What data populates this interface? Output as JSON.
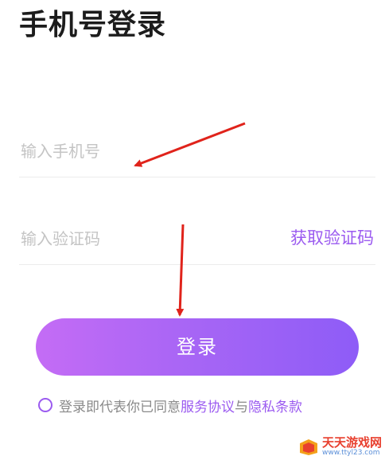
{
  "header": {
    "title": "手机号登录"
  },
  "phone": {
    "placeholder": "输入手机号"
  },
  "code": {
    "placeholder": "输入验证码",
    "get_code_label": "获取验证码"
  },
  "login": {
    "label": "登录"
  },
  "agreement": {
    "prefix": "登录即代表你已同意",
    "service_link": "服务协议",
    "conjunction": "与",
    "privacy_link": "隐私条款"
  },
  "watermark": {
    "name": "天天游戏网",
    "url": "www.ttyl23.com"
  },
  "colors": {
    "accent": "#9b5bf0",
    "button_gradient_start": "#c46cf5",
    "button_gradient_end": "#8e5cf7",
    "annotation_arrow": "#e0231b"
  }
}
